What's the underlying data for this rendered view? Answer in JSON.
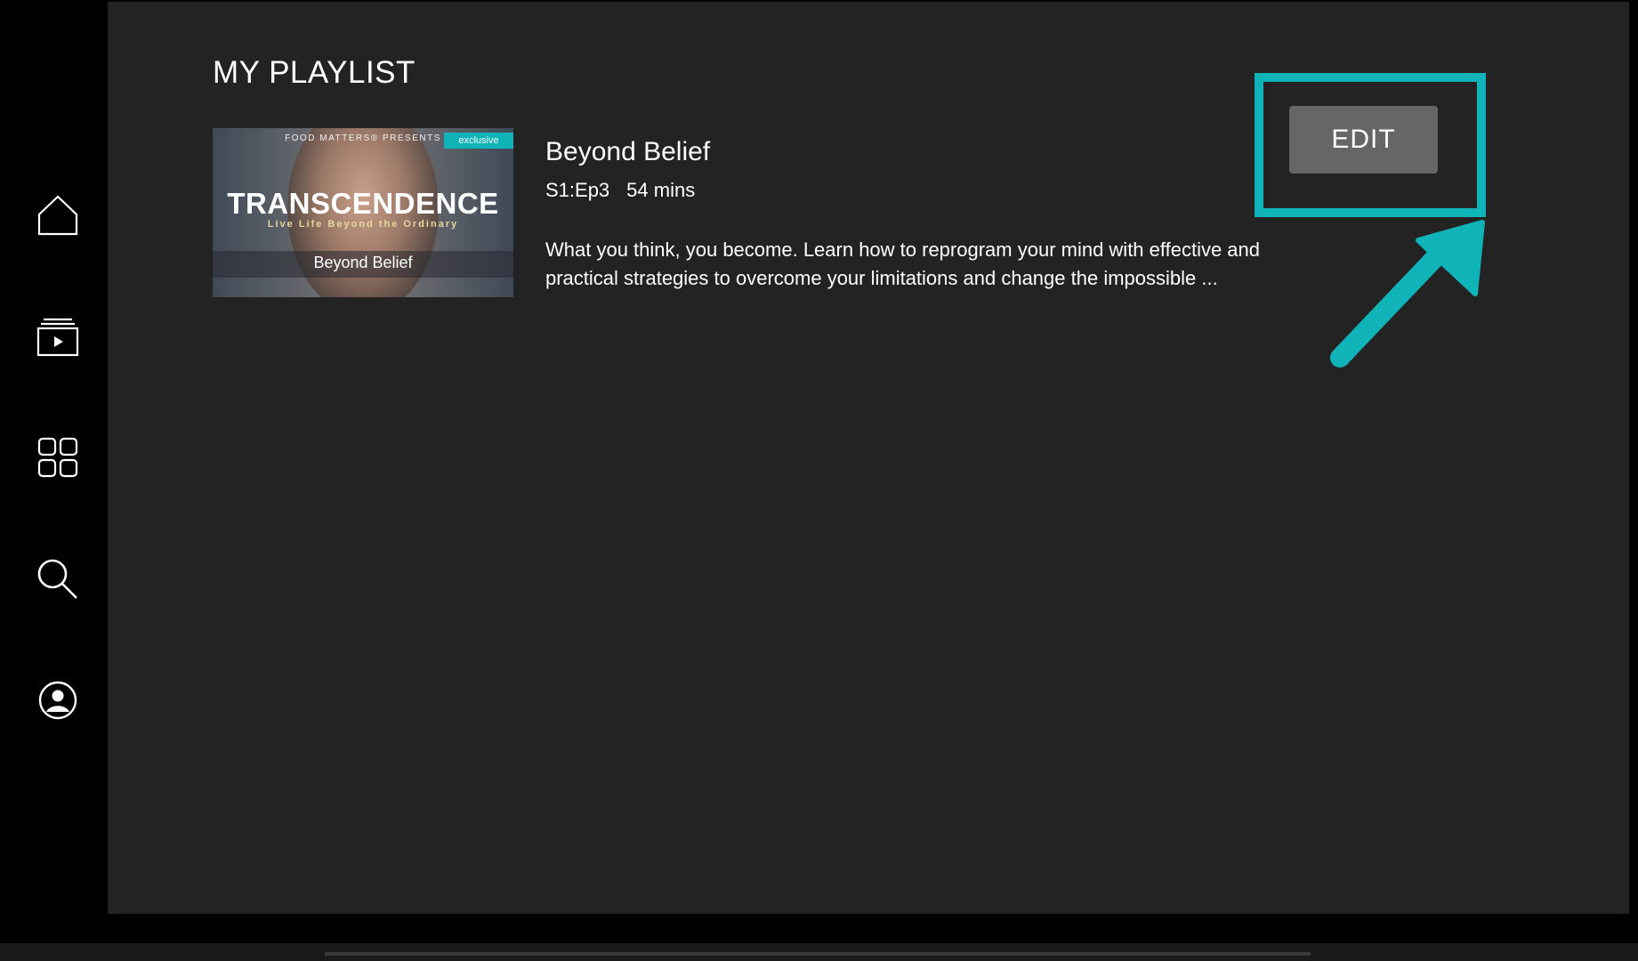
{
  "page": {
    "title": "MY PLAYLIST"
  },
  "sidebar": {
    "items": [
      {
        "icon": "home-icon"
      },
      {
        "icon": "library-icon"
      },
      {
        "icon": "grid-icon"
      },
      {
        "icon": "search-icon"
      },
      {
        "icon": "profile-icon"
      }
    ]
  },
  "playlist": {
    "items": [
      {
        "thumbnail": {
          "presents": "FOOD MATTERS® PRESENTS",
          "badge": "exclusive",
          "brand": "TRANSCENDENCE",
          "tagline": "Live Life Beyond the Ordinary",
          "title": "Beyond Belief"
        },
        "title": "Beyond Belief",
        "episode": "S1:Ep3",
        "duration": "54 mins",
        "description": "What you think, you become. Learn how to reprogram your mind with effective and practical strategies to overcome your limitations and change the impossible ..."
      }
    ]
  },
  "toolbar": {
    "edit_label": "EDIT"
  },
  "colors": {
    "accent": "#10b3b8",
    "background": "#232323",
    "sidebar": "#000000",
    "button": "#666666"
  }
}
